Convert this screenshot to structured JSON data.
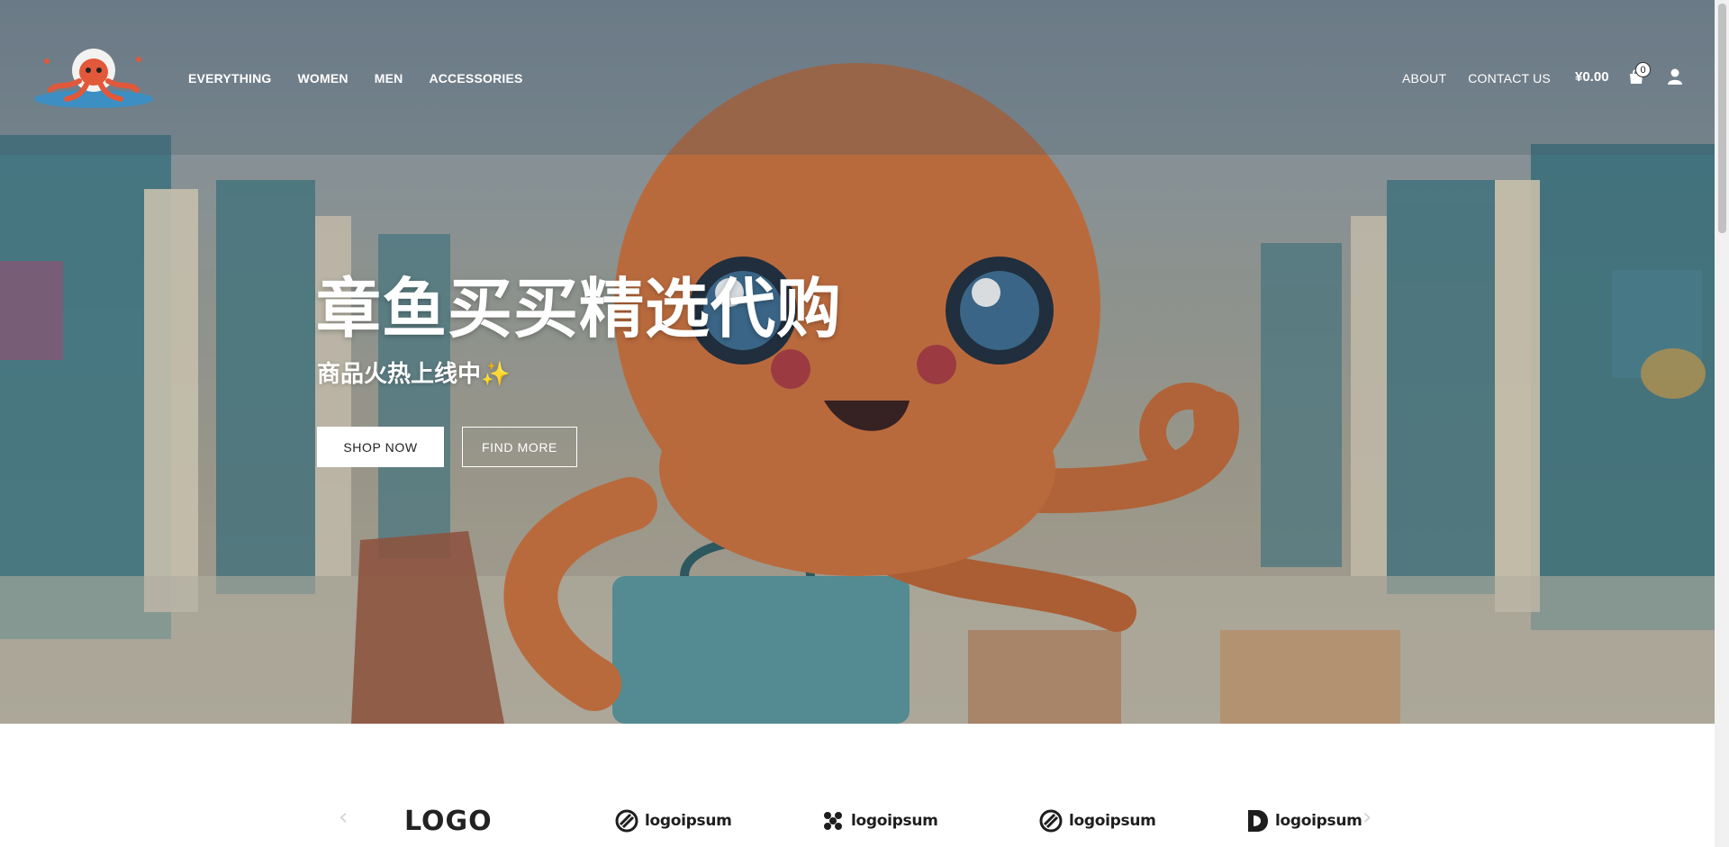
{
  "nav": {
    "logo_alt": "octopus-logo",
    "main": [
      {
        "label": "EVERYTHING"
      },
      {
        "label": "WOMEN"
      },
      {
        "label": "MEN"
      },
      {
        "label": "ACCESSORIES"
      }
    ],
    "secondary": [
      {
        "label": "ABOUT"
      },
      {
        "label": "CONTACT US"
      }
    ],
    "cart": {
      "total": "¥0.00",
      "count": "0",
      "icon": "shopping-bag-icon"
    },
    "account_icon": "user-icon"
  },
  "hero": {
    "title": "章鱼买买精选代购",
    "subtitle": "商品火热上线中✨",
    "buttons": [
      {
        "label": "SHOP NOW"
      },
      {
        "label": "FIND MORE"
      }
    ]
  },
  "brand_carousel": {
    "prev_icon": "chevron-left-icon",
    "next_icon": "chevron-right-icon",
    "brands": [
      {
        "label": "LOGO"
      },
      {
        "label": "logoipsum"
      },
      {
        "label": "logoipsum"
      },
      {
        "label": "logoipsum"
      },
      {
        "label": "logoipsum"
      }
    ]
  },
  "colors": {
    "header_text": "#ffffff",
    "primary_button_bg": "#ffffff",
    "octopus_orange": "#d9753a"
  }
}
